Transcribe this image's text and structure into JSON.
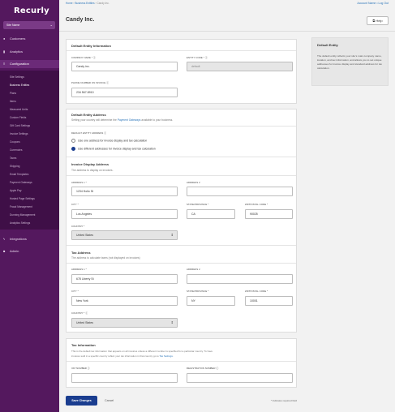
{
  "app": {
    "logo": "Recurly"
  },
  "sidebar": {
    "site_select": "Site Name",
    "main": [
      {
        "label": "Customers",
        "icon": "users-icon",
        "glyph": "👥"
      },
      {
        "label": "Analytics",
        "icon": "chart-icon",
        "glyph": "▮"
      },
      {
        "label": "Configuration",
        "icon": "sliders-icon",
        "glyph": "⚙"
      },
      {
        "label": "Integrations",
        "icon": "plug-icon",
        "glyph": "⚡"
      },
      {
        "label": "Admin",
        "icon": "lock-icon",
        "glyph": "🔒"
      }
    ],
    "config_items": [
      "Site Settings",
      "Business Entities",
      "Plans",
      "Items",
      "Measured Units",
      "Custom Fields",
      "Gift Card Settings",
      "Invoice Settings",
      "Coupons",
      "Currencies",
      "Taxes",
      "Shipping",
      "Email Templates",
      "Payment Gateways",
      "Apple Pay",
      "Hosted Page Settings",
      "Fraud Management",
      "Dunning Management",
      "Analytics Settings"
    ]
  },
  "header": {
    "breadcrumb": {
      "home": "Home",
      "sep": "›",
      "entities": "Business Entities",
      "current": "Candy Inc."
    },
    "account": "Account Name",
    "logout": "Log Out",
    "title": "Candy Inc.",
    "help": "Help"
  },
  "default_entity": {
    "title": "Default Entity Information",
    "company_label": "COMPANY NAME *",
    "company_value": "Candy inc.",
    "entity_code_label": "ENTITY CODE *",
    "entity_code_value": "default",
    "phone_label": "PHONE NUMBER ON INVOICE",
    "phone_value": "234 567-8910"
  },
  "default_address": {
    "title": "Default Entity Address",
    "sub_pre": "Setting your country will determine the",
    "sub_link": "Payment Gateways",
    "sub_post": "available to your business.",
    "option_label": "DEFAULT ENTITY ADDRESS",
    "option_same": "Use one address for invoice display and tax calculation",
    "option_diff": "Use different addresses for invoice display and tax calculation"
  },
  "invoice_address": {
    "title": "Invoice Display Address",
    "sub": "The address to display on invoices.",
    "addr1_label": "ADDRESS 1 *",
    "addr1_value": "1234 Hollo St",
    "addr2_label": "ADDRESS 2",
    "addr2_value": "",
    "city_label": "CITY *",
    "city_value": "Los Angeles",
    "state_label": "STATE/PROVINCE *",
    "state_value": "CA",
    "zip_label": "ZIP/POSTAL CODE *",
    "zip_value": "90025",
    "country_label": "COUNTRY *",
    "country_value": "United States"
  },
  "tax_address": {
    "title": "Tax Address",
    "sub": "The address to calculate taxes (not displayed on invoices)",
    "addr1_label": "ADDRESS 1 *",
    "addr1_value": "678 Liberty St",
    "addr2_label": "ADDRESS 2",
    "addr2_value": "",
    "city_label": "CITY *",
    "city_value": "New York",
    "state_label": "STATE/PROVINCE *",
    "state_value": "NY",
    "zip_label": "ZIP/POSTAL CODE *",
    "zip_value": "10001",
    "country_label": "COUNTRY *",
    "country_value": "United States"
  },
  "tax_info": {
    "title": "Tax Information",
    "sub1": "This is the default tax information that appears on all invoices unless a different number is specified for a particular country. To have",
    "sub2_pre": "invoices sold in a specific country reflect your tax information in that country go to",
    "sub2_link": "Tax Settings",
    "sub2_post": ".",
    "vat_label": "VAT NUMBER",
    "vat_value": "",
    "reg_label": "REGISTRATION NUMBER",
    "reg_value": ""
  },
  "info_panel": {
    "title": "Default Entity",
    "text": "The default entity reflects your site's main company name, location, and tax information, and allows you to set unique addresses for invoice display and standard address for tax calculation."
  },
  "footer": {
    "save": "Save Changes",
    "cancel": "Cancel",
    "required_note": "* Indicates required field"
  },
  "colors": {
    "sidebar": "#54185e",
    "primary": "#1a3d8f",
    "link": "#2a74b8"
  }
}
